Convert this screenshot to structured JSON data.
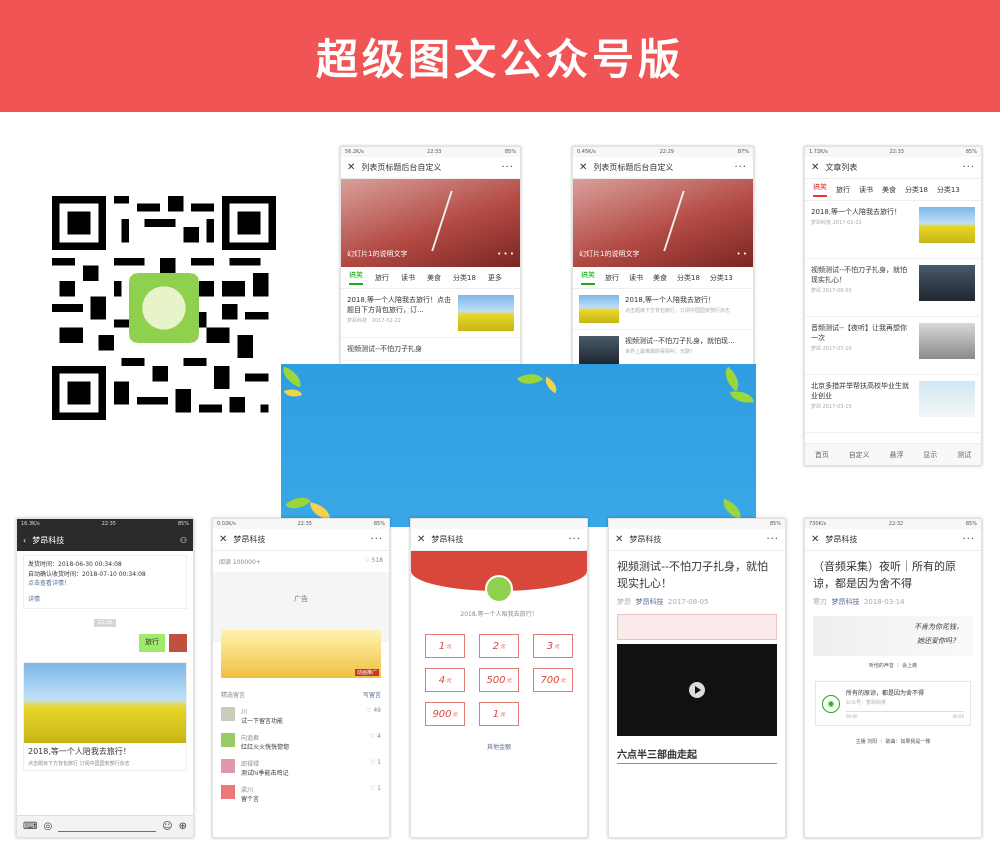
{
  "banner": {
    "title": "超级图文公众号版"
  },
  "phones": {
    "p1": {
      "status_left": "56.2K/s",
      "status_time": "22:33",
      "status_right": "85%",
      "title": "列表页标题后台自定义",
      "slide_caption": "幻灯片1的说明文字",
      "tabs": [
        "搞笑",
        "旅行",
        "读书",
        "美食",
        "分类18",
        "更多"
      ],
      "article1": {
        "title": "2018,等一个人陪我去旅行！点击题目下方背包旅行，订...",
        "source": "梦昂科技",
        "date": "2017-02-22"
      },
      "article2": {
        "title": "视频测试--不怕刀子扎身"
      }
    },
    "p2": {
      "status_left": "0.45K/s",
      "status_time": "22:29",
      "status_right": "87%",
      "title": "列表页标题后台自定义",
      "slide_caption": "幻灯片1的说明文字",
      "tabs": [
        "搞笑",
        "旅行",
        "读书",
        "美食",
        "分类18",
        "分类13"
      ],
      "article1": {
        "title": "2018,等一个人陪我去旅行！",
        "desc": "点击题目下方背包旅行，订阅中国国安部行杂志"
      },
      "article2": {
        "title": "视频测试--不怕刀子扎身，就怕现...",
        "desc": "世界上最难做的事情叫：无聊！"
      }
    },
    "p3": {
      "status_left": "1.72K/s",
      "status_time": "22:33",
      "status_right": "85%",
      "title": "文章列表",
      "tabs": [
        "搞笑",
        "旅行",
        "读书",
        "美食",
        "分类18",
        "分类13"
      ],
      "articles": [
        {
          "title": "2018,等一个人陪我去旅行！",
          "meta": "梦昂科技  2017-02-22"
        },
        {
          "title": "视频测试--不怕刀子扎身，就怕现实扎心！",
          "meta": "梦昂  2017-08-05"
        },
        {
          "title": "音频测试--【夜听】让我再想你一次",
          "meta": "梦昂  2017-07-10"
        },
        {
          "title": "北京多措并举帮扶高校毕业生就业创业",
          "meta": "梦昂  2017-03-15"
        }
      ],
      "nav": [
        "首页",
        "自定义",
        "悬浮",
        "显示",
        "测试"
      ]
    },
    "p4": {
      "status_left": "16.3K/s",
      "status_time": "22:35",
      "status_right": "85%",
      "title": "梦昂科技",
      "card_lines": [
        "发货时间：2018-06-30 00:34:08",
        "自动确认收货时间：2018-07-10 00:34:08",
        "点击查看详情！"
      ],
      "detail": "详情",
      "time_chip": "22:28",
      "bubble": "旅行",
      "share": {
        "title": "2018,等一个人陪我去旅行！",
        "desc": "点击题目下方背包旅行    订阅中国国安部行杂志"
      }
    },
    "p5": {
      "status_left": "0.02K/s",
      "status_time": "22:35",
      "status_right": "85%",
      "title": "梦昂科技",
      "reads": "阅读 100000+",
      "likes": "518",
      "ad": "广告",
      "ad_tag": "动画推广",
      "comments_title": "精选留言",
      "write": "写留言",
      "comments": [
        {
          "name": "川",
          "text": "试一下留言功能",
          "likes": "49"
        },
        {
          "name": "向追君",
          "text": "红红火火恍恍惚惚",
          "likes": "4"
        },
        {
          "name": "邱禄禄",
          "text": "测试hi季能击鸡记",
          "likes": "1"
        },
        {
          "name": "梁川",
          "text": "留个言",
          "likes": "1"
        }
      ]
    },
    "p6": {
      "title": "梦昂科技",
      "subtitle": "2018,等一个人陪我去旅行！",
      "amounts": [
        "1",
        "2",
        "3",
        "4",
        "500",
        "700",
        "900",
        "1"
      ],
      "unit": "元",
      "other": "其他金额"
    },
    "p7": {
      "status_right": "85%",
      "title": "梦昂科技",
      "headline": "视频测试--不怕刀子扎身，就怕现实扎心！",
      "author": "梦昂",
      "account": "梦昂科技",
      "date": "2017-08-05",
      "banner_text": "六点半三部曲走起"
    },
    "p8": {
      "status_left": "730K/s",
      "status_time": "22:32",
      "status_right": "85%",
      "title": "梦昂科技",
      "headline": "（音频采集）夜听｜所有的原谅，都是因为舍不得",
      "author": "寒刃",
      "account": "梦昂科技",
      "date": "2018-03-14",
      "quote1": "不肯为你花钱，",
      "quote2": "她还爱你吗？",
      "caption": "听他的声音 ｜ 会上瘾",
      "audio_title": "所有的原谅，都是因为舍不得",
      "audio_src": "公众号：梦昂科技",
      "audio_start": "00:00",
      "audio_end": "00:00",
      "footer": "主播 刘阳 ｜ 歌曲：如果我是一棵"
    }
  },
  "colors": {
    "banner": "#f05454",
    "wechat_green": "#1aad19",
    "accent_red": "#d9473b",
    "overlay_blue": "#2f9ee0"
  }
}
